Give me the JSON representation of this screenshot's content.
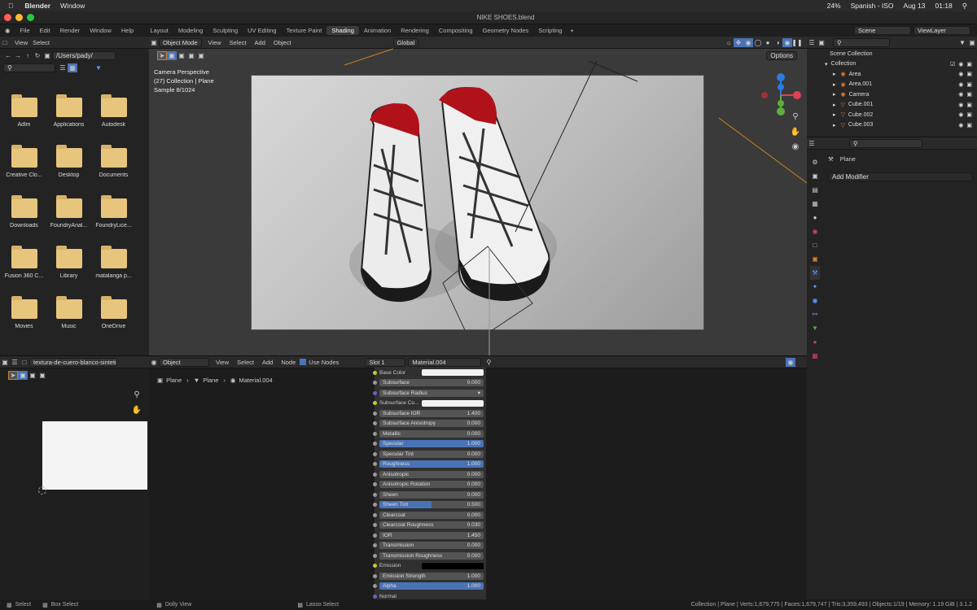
{
  "macbar": {
    "app": "Blender",
    "window": "Window",
    "battery": "24%",
    "lang": "Spanish - ISO",
    "date": "Aug 13",
    "time": "01:18"
  },
  "window_title": "NIKE SHOES.blend",
  "menu": {
    "items": [
      "File",
      "Edit",
      "Render",
      "Window",
      "Help"
    ],
    "tabs": [
      "Layout",
      "Modeling",
      "Sculpting",
      "UV Editing",
      "Texture Paint",
      "Shading",
      "Animation",
      "Rendering",
      "Compositing",
      "Geometry Nodes",
      "Scripting"
    ],
    "active": "Shading",
    "scene": "Scene",
    "viewlayer": "ViewLayer"
  },
  "files": {
    "header": [
      "View",
      "Select"
    ],
    "path": "/Users/pady/",
    "folders": [
      "Adlm",
      "Applications",
      "Autodesk",
      "Creative Clo...",
      "Desktop",
      "Documents",
      "Downloads",
      "FoundryAnal...",
      "FoundryLice...",
      "Fusion 360 C...",
      "Library",
      "matalanga p...",
      "Movies",
      "Music",
      "OneDrive"
    ]
  },
  "viewport": {
    "mode": "Object Mode",
    "menus": [
      "View",
      "Select",
      "Add",
      "Object"
    ],
    "orientation": "Global",
    "options": "Options",
    "info": [
      "Camera Perspective",
      "(27) Collection | Plane",
      "Sample 8/1024"
    ]
  },
  "outliner": {
    "root": "Scene Collection",
    "collection": "Collection",
    "items": [
      "Area",
      "Area.001",
      "Camera",
      "Cube.001",
      "Cube.002",
      "Cube.003"
    ]
  },
  "properties": {
    "object": "Plane",
    "add_modifier": "Add Modifier"
  },
  "imgedit": {
    "name": "textura-de-cuero-blanco-sintetico"
  },
  "nodes": {
    "object": "Object",
    "menus": [
      "View",
      "Select",
      "Add",
      "Node"
    ],
    "use_nodes": "Use Nodes",
    "slot": "Slot 1",
    "material": "Material.004",
    "breadcrumb": [
      "Plane",
      "Plane",
      "Material.004"
    ],
    "rows": [
      {
        "label": "Base Color",
        "value": "",
        "kind": "color",
        "sock": "#c7c729"
      },
      {
        "label": "Subsurface",
        "value": "0.000",
        "kind": "num",
        "sock": "#999"
      },
      {
        "label": "Subsurface Radius",
        "value": "",
        "kind": "drop",
        "sock": "#6363c7"
      },
      {
        "label": "Subsurface Co...",
        "value": "",
        "kind": "color",
        "sock": "#c7c729"
      },
      {
        "label": "Subsurface IOR",
        "value": "1.400",
        "kind": "num",
        "sock": "#999"
      },
      {
        "label": "Subsurface Anisotropy",
        "value": "0.000",
        "kind": "num",
        "sock": "#999"
      },
      {
        "label": "Metallic",
        "value": "0.000",
        "kind": "num",
        "sock": "#999"
      },
      {
        "label": "Specular",
        "value": "1.000",
        "kind": "full",
        "sock": "#999"
      },
      {
        "label": "Specular Tint",
        "value": "0.000",
        "kind": "num",
        "sock": "#999"
      },
      {
        "label": "Roughness",
        "value": "1.000",
        "kind": "full",
        "sock": "#999"
      },
      {
        "label": "Anisotropic",
        "value": "0.000",
        "kind": "num",
        "sock": "#999"
      },
      {
        "label": "Anisotropic Rotation",
        "value": "0.000",
        "kind": "num",
        "sock": "#999"
      },
      {
        "label": "Sheen",
        "value": "0.000",
        "kind": "num",
        "sock": "#999"
      },
      {
        "label": "Sheen Tint",
        "value": "0.500",
        "kind": "half",
        "sock": "#999"
      },
      {
        "label": "Clearcoat",
        "value": "0.000",
        "kind": "num",
        "sock": "#999"
      },
      {
        "label": "Clearcoat Roughness",
        "value": "0.030",
        "kind": "num",
        "sock": "#999"
      },
      {
        "label": "IOR",
        "value": "1.450",
        "kind": "num",
        "sock": "#999"
      },
      {
        "label": "Transmission",
        "value": "0.000",
        "kind": "num",
        "sock": "#999"
      },
      {
        "label": "Transmission Roughness",
        "value": "0.000",
        "kind": "num",
        "sock": "#999"
      },
      {
        "label": "Emission",
        "value": "",
        "kind": "black",
        "sock": "#c7c729"
      },
      {
        "label": "Emission Strength",
        "value": "1.000",
        "kind": "num",
        "sock": "#999"
      },
      {
        "label": "Alpha",
        "value": "1.000",
        "kind": "full",
        "sock": "#999"
      },
      {
        "label": "Normal",
        "value": "",
        "kind": "label",
        "sock": "#6363c7"
      }
    ]
  },
  "status": {
    "left": [
      "Select",
      "Box Select",
      "Dolly View",
      "Lasso Select"
    ],
    "right": "Collection | Plane | Verts:1,679,775 | Faces:1,679,747 | Tris:3,359,493 | Objects:1/19 | Memory: 1.19 GiB | 3.1.2"
  }
}
